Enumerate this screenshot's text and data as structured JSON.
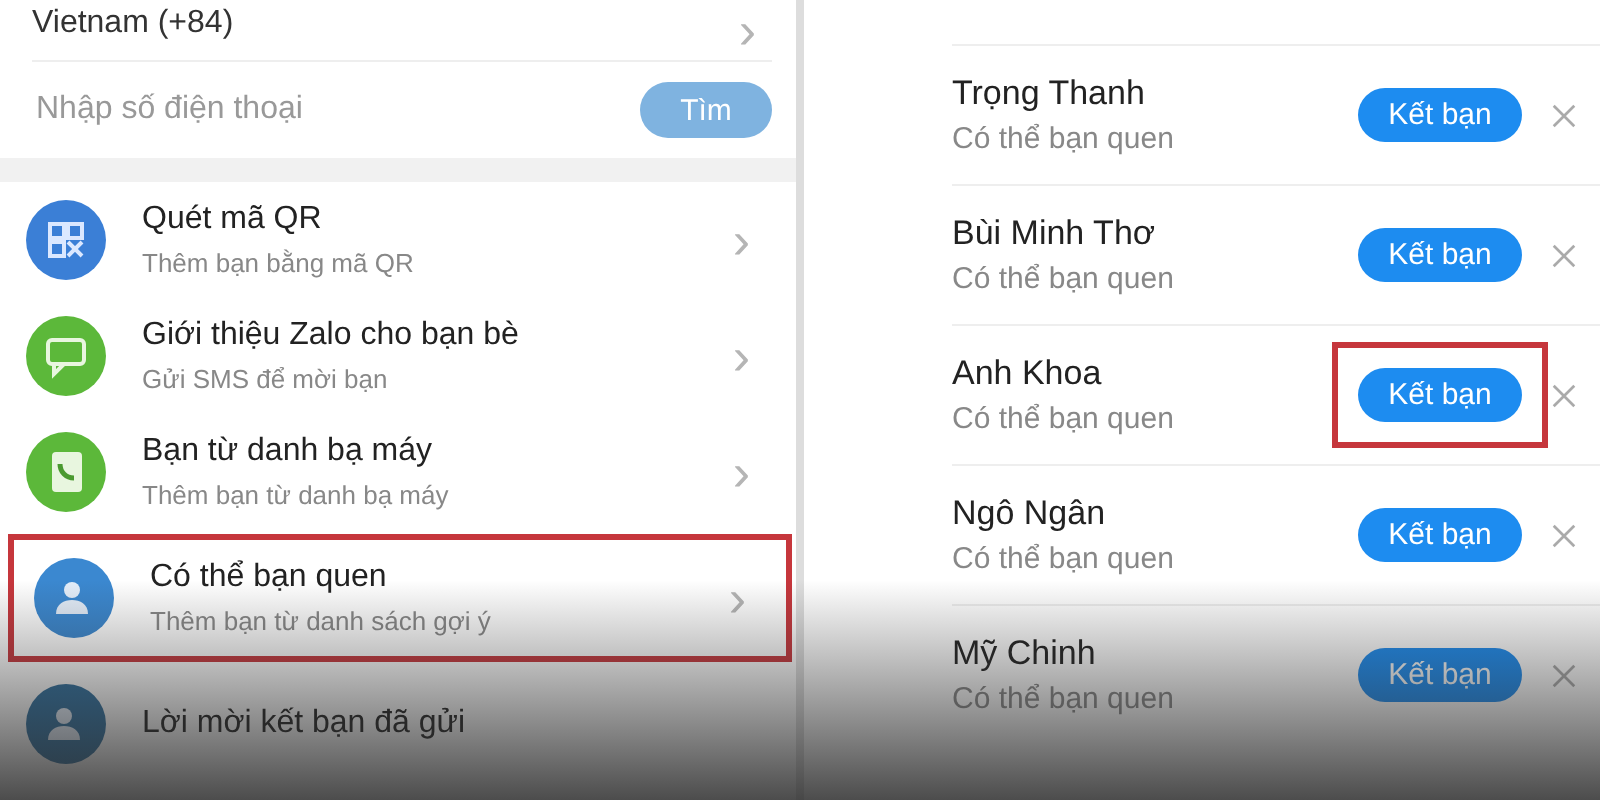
{
  "left_panel": {
    "country": {
      "label": "Vietnam (+84)",
      "chevron": "›"
    },
    "phone_search": {
      "placeholder": "Nhập số điện thoại",
      "button": "Tìm",
      "disabled": true
    },
    "items": [
      {
        "kind": "qr",
        "title": "Quét mã QR",
        "subtitle": "Thêm bạn bằng mã QR",
        "color": "#3b7fd6",
        "highlighted": false
      },
      {
        "kind": "sms",
        "title": "Giới thiệu Zalo cho bạn bè",
        "subtitle": "Gửi SMS để mời bạn",
        "color": "#5cb83a",
        "highlighted": false
      },
      {
        "kind": "contacts",
        "title": "Bạn từ danh bạ máy",
        "subtitle": "Thêm bạn từ danh bạ máy",
        "color": "#5cb83a",
        "highlighted": false
      },
      {
        "kind": "person",
        "title": "Có thể bạn quen",
        "subtitle": "Thêm bạn từ danh sách gợi ý",
        "color": "#3b88d0",
        "highlighted": true
      },
      {
        "kind": "person",
        "title": "Lời mời kết bạn đã gửi",
        "highlighted": false
      }
    ]
  },
  "right_panel": {
    "suggestions": [
      {
        "name": "Trọng Thanh",
        "subtitle": "Có thể bạn quen",
        "button": "Kết bạn",
        "highlighted": false
      },
      {
        "name": "Bùi Minh Thơ",
        "subtitle": "Có thể bạn quen",
        "button": "Kết bạn",
        "highlighted": false
      },
      {
        "name": "Anh Khoa",
        "subtitle": "Có thể bạn quen",
        "button": "Kết bạn",
        "highlighted": true
      },
      {
        "name": "Ngô Ngân",
        "subtitle": "Có thể bạn quen",
        "button": "Kết bạn",
        "highlighted": false
      },
      {
        "name": "Mỹ Chinh",
        "subtitle": "Có thể bạn quen",
        "button": "Kết bạn",
        "highlighted": false
      }
    ]
  }
}
